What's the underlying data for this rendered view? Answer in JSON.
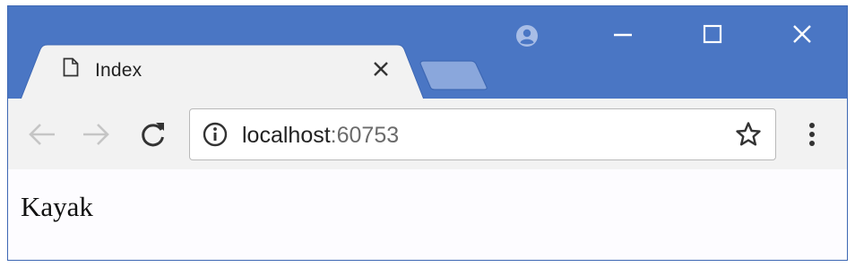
{
  "tab": {
    "title": "Index"
  },
  "address_bar": {
    "host": "localhost",
    "port": ":60753"
  },
  "page": {
    "text": "Kayak"
  },
  "icons": {
    "profile": "profile-icon",
    "minimize": "minimize-icon",
    "maximize": "maximize-icon",
    "close": "close-icon",
    "tab_page": "document-icon",
    "tab_close": "close-icon",
    "back": "arrow-left-icon",
    "forward": "arrow-right-icon",
    "reload": "reload-icon",
    "site_info": "info-icon",
    "bookmark": "star-icon",
    "menu": "more-vertical-icon"
  },
  "colors": {
    "frame": "#4a76c4",
    "toolbar": "#f2f2f2",
    "page_background": "#fdfcff"
  }
}
